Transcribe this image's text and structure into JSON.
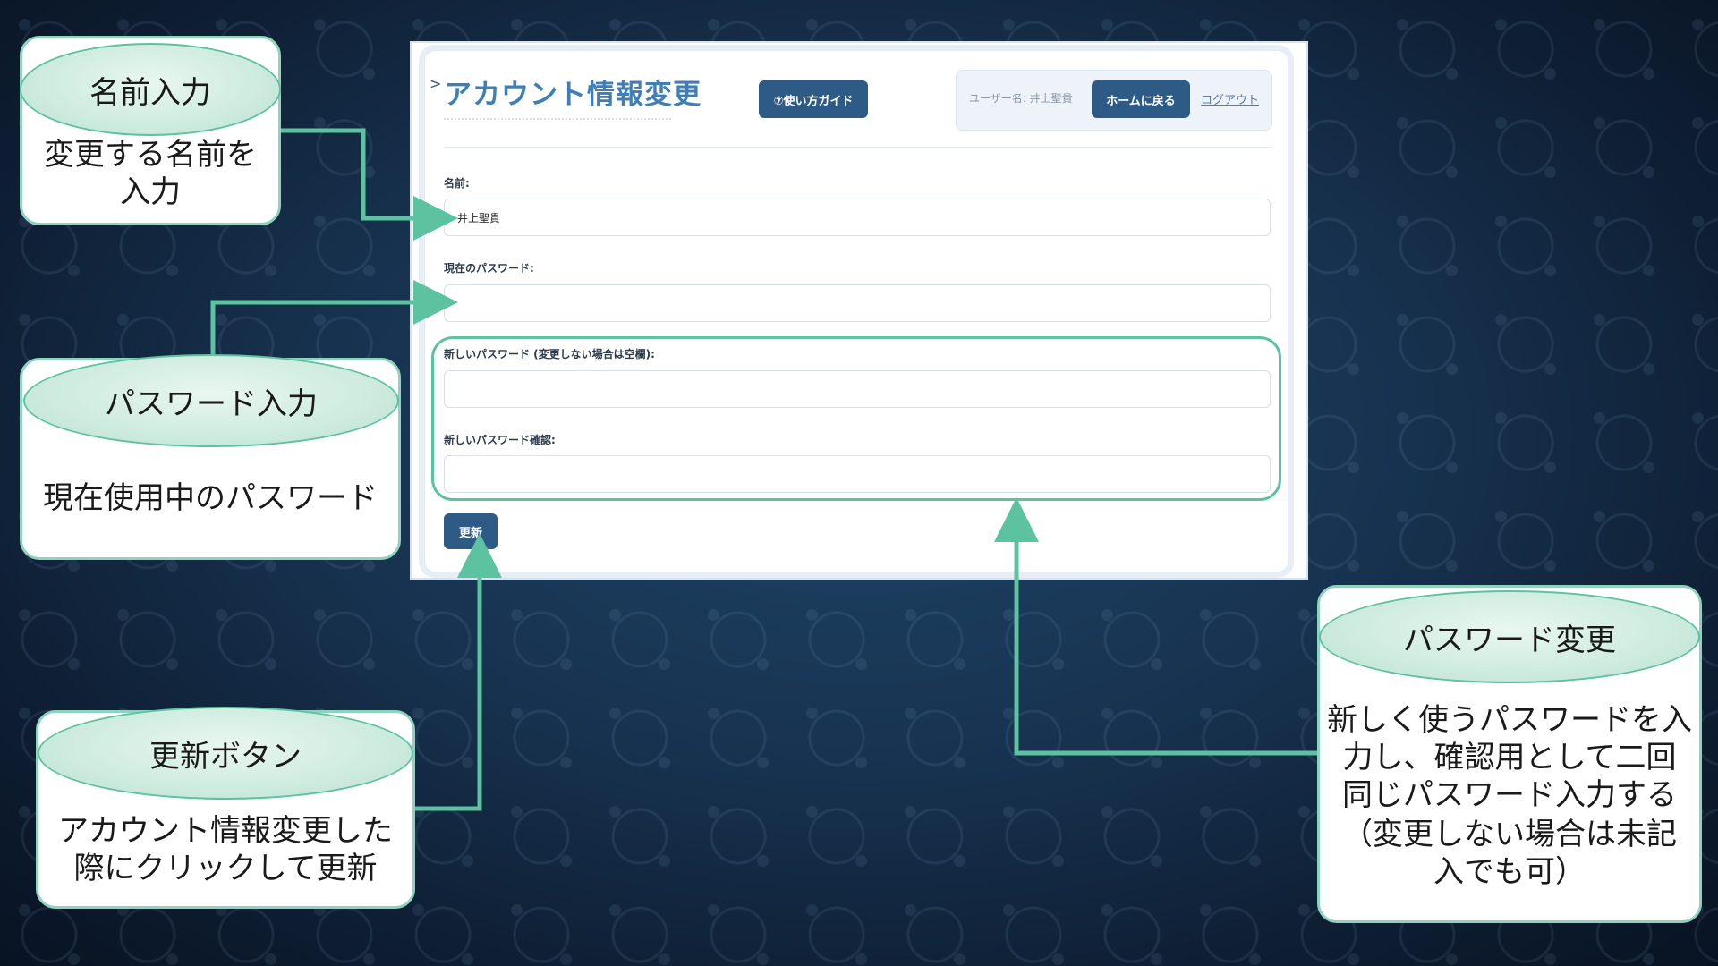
{
  "app": {
    "page_title": "アカウント情報変更",
    "guide_button": "⑦使い方ガイド",
    "user_label": "ユーザー名:  井上聖貴",
    "home_button": "ホームに戻る",
    "logout_link": "ログアウト"
  },
  "form": {
    "name_label": "名前:",
    "name_value": "井上聖貴",
    "current_password_label": "現在のパスワード:",
    "new_password_label": "新しいパスワード (変更しない場合は空欄):",
    "confirm_password_label": "新しいパスワード確認:",
    "update_button": "更新"
  },
  "callouts": {
    "name": {
      "title": "名前入力",
      "body1": "変更する名前を",
      "body2": "入力"
    },
    "password": {
      "title": "パスワード入力",
      "body1": "現在使用中のパスワード"
    },
    "update": {
      "title": "更新ボタン",
      "body1": "アカウント情報変更した",
      "body2": "際にクリックして更新"
    },
    "change": {
      "title": "パスワード変更",
      "body1": "新しく使うパスワードを入",
      "body2": "力し、確認用として二回",
      "body3": "同じパスワード入力する",
      "body4": "（変更しない場合は未記",
      "body5": "入でも可）"
    }
  },
  "colors": {
    "accent_green": "#5cc29f",
    "button_blue": "#2d5b86",
    "title_blue": "#3f7fb6"
  }
}
